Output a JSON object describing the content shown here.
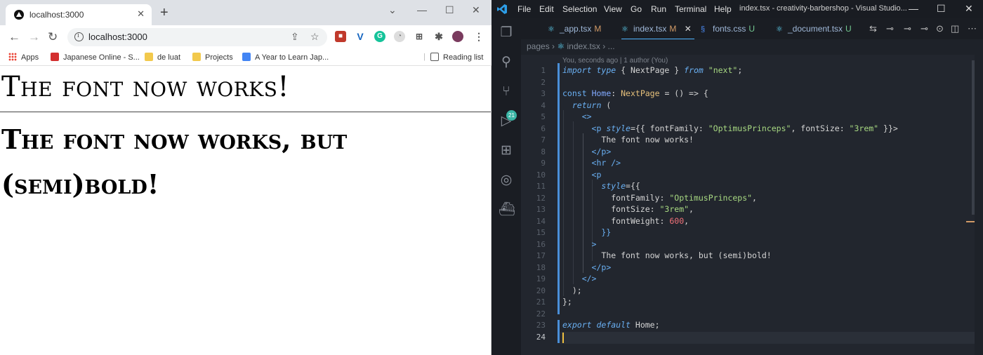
{
  "browser": {
    "tab_title": "localhost:3000",
    "url": "localhost:3000",
    "bookmarks": [
      "Apps",
      "Japanese Online - S...",
      "de luat",
      "Projects",
      "A Year to Learn Jap..."
    ],
    "reading_list": "Reading list",
    "content": {
      "line1": "The font now works!",
      "line2": "The font now works, but (semi)bold!"
    }
  },
  "vscode": {
    "menu": [
      "File",
      "Edit",
      "Selection",
      "View",
      "Go",
      "Run",
      "Terminal",
      "Help"
    ],
    "window_title": "index.tsx - creativity-barbershop - Visual Studio...",
    "scm_badge": "21",
    "tabs": [
      {
        "name": "_app.tsx",
        "status": "M"
      },
      {
        "name": "index.tsx",
        "status": "M",
        "active": true
      },
      {
        "name": "fonts.css",
        "status": "U"
      },
      {
        "name": "_document.tsx",
        "status": "U"
      }
    ],
    "breadcrumbs": [
      "pages",
      "index.tsx",
      "..."
    ],
    "blame": "You, seconds ago | 1 author (You)",
    "line_numbers": [
      "1",
      "2",
      "3",
      "4",
      "5",
      "6",
      "7",
      "8",
      "9",
      "10",
      "11",
      "12",
      "13",
      "14",
      "15",
      "16",
      "17",
      "18",
      "19",
      "20",
      "21",
      "22",
      "23",
      "24"
    ],
    "code": {
      "l1_kw1": "import",
      "l1_kw2": "type",
      "l1_name": "NextPage",
      "l1_from": "from",
      "l1_str": "\"next\"",
      "l3_const": "const",
      "l3_name": "Home",
      "l3_type": "NextPage",
      "l3_rest": " = () => {",
      "l4_return": "return",
      "l4_rest": " (",
      "l5": "<>",
      "l6_tag": "<p",
      "l6_attr": "style",
      "l6_a": "={{ fontFamily: ",
      "l6_str1": "\"OptimusPrinceps\"",
      "l6_b": ", fontSize: ",
      "l6_str2": "\"3rem\"",
      "l6_c": " }}>",
      "l7": "The font now works!",
      "l8": "</p>",
      "l9": "<hr />",
      "l10": "<p",
      "l11_attr": "style",
      "l11_rest": "={{",
      "l12_key": "fontFamily: ",
      "l12_str": "\"OptimusPrinceps\"",
      "l12_end": ",",
      "l13_key": "fontSize: ",
      "l13_str": "\"3rem\"",
      "l13_end": ",",
      "l14_key": "fontWeight: ",
      "l14_num": "600",
      "l14_end": ",",
      "l15": "}}",
      "l16": ">",
      "l17": "The font now works, but (semi)bold!",
      "l18": "</p>",
      "l19": "</>",
      "l20": ");",
      "l21": "};",
      "l23_kw1": "export",
      "l23_kw2": "default",
      "l23_name": "Home",
      "l23_end": ";"
    }
  }
}
